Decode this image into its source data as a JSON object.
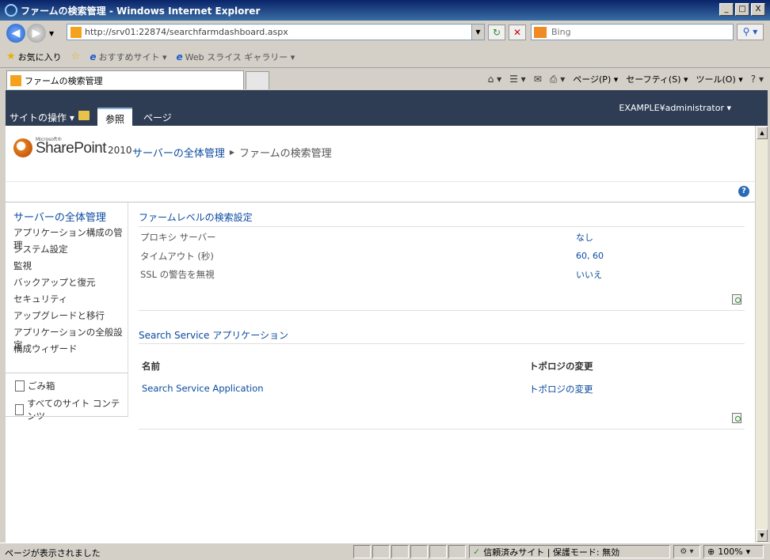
{
  "window": {
    "title": "ファームの検索管理 - Windows Internet Explorer",
    "minimize": "_",
    "maximize": "□",
    "close": "X"
  },
  "address": {
    "url": "http://srv01:22874/searchfarmdashboard.aspx",
    "search_placeholder": "Bing"
  },
  "favorites": {
    "label": "お気に入り",
    "suggested": "おすすめサイト ▾",
    "web_slice": "Web スライス ギャラリー ▾"
  },
  "tab": {
    "title": "ファームの検索管理"
  },
  "command_bar": {
    "page": "ページ(P) ▾",
    "safety": "セーフティ(S) ▾",
    "tools": "ツール(O) ▾"
  },
  "ribbon": {
    "site_actions": "サイトの操作 ▾",
    "tab_browse": "参照",
    "tab_page": "ページ",
    "user": "EXAMPLE¥administrator ▾"
  },
  "header": {
    "brand_ms": "Microsoft®",
    "brand": "SharePoint",
    "version": "2010",
    "breadcrumb_root": "サーバーの全体管理",
    "breadcrumb_current": "ファームの検索管理"
  },
  "leftnav": {
    "heading": "サーバーの全体管理",
    "items": [
      "アプリケーション構成の管理",
      "システム設定",
      "監視",
      "バックアップと復元",
      "セキュリティ",
      "アップグレードと移行",
      "アプリケーションの全般設定",
      "構成ウィザード"
    ],
    "recycle_bin": "ごみ箱",
    "all_content": "すべてのサイト コンテンツ"
  },
  "farm_settings": {
    "title": "ファームレベルの検索設定",
    "rows": [
      {
        "label": "プロキシ サーバー",
        "value": "なし"
      },
      {
        "label": "タイムアウト (秒)",
        "value": "60, 60"
      },
      {
        "label": "SSL の警告を無視",
        "value": "いいえ"
      }
    ]
  },
  "search_apps": {
    "title": "Search Service アプリケーション",
    "col_name": "名前",
    "col_topology": "トポロジの変更",
    "rows": [
      {
        "name": "Search Service Application",
        "topology": "トポロジの変更"
      }
    ]
  },
  "status": {
    "text": "ページが表示されました",
    "zone": "信頼済みサイト | 保護モード: 無効",
    "zoom": "100%"
  }
}
